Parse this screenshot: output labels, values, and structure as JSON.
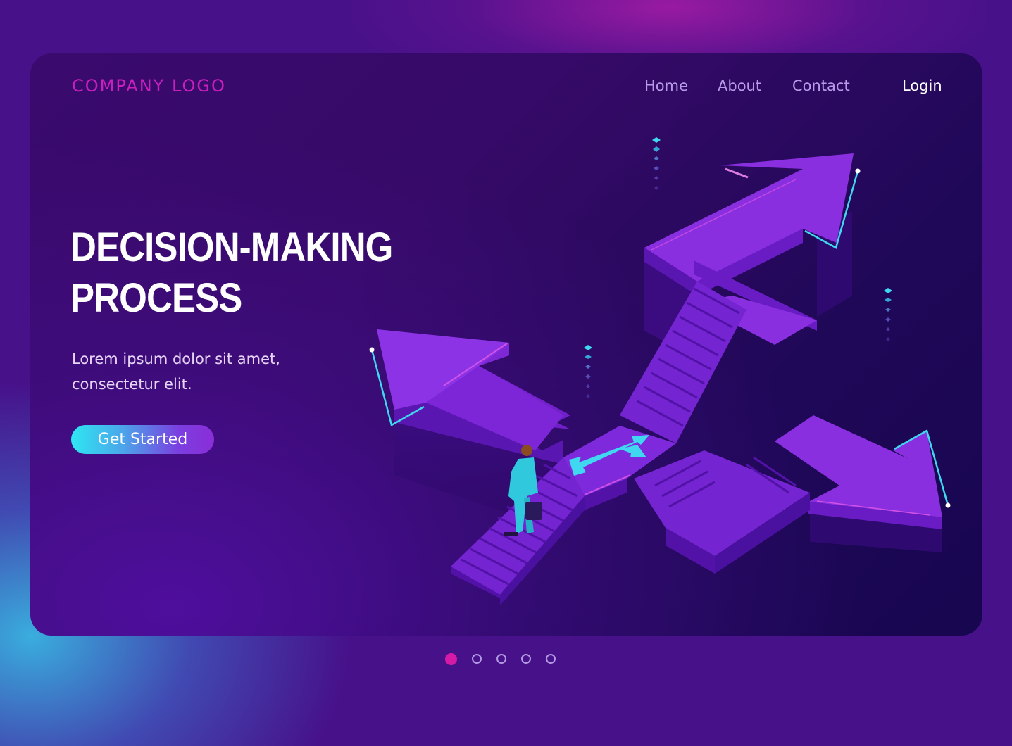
{
  "header": {
    "logo_text": "COMPANY LOGO",
    "nav": [
      {
        "label": "Home"
      },
      {
        "label": "About"
      },
      {
        "label": "Contact"
      },
      {
        "label": "Login"
      }
    ]
  },
  "hero": {
    "title_line1": "DECISION-MAKING",
    "title_line2": "PROCESS",
    "subtitle_line1": "Lorem ipsum dolor sit amet,",
    "subtitle_line2": "consectetur elit.",
    "cta_label": "Get Started"
  },
  "illustration": {
    "subject": "isometric staircase with three directional arrows and businessman",
    "arrows": [
      "up-left",
      "up-right",
      "down-right"
    ],
    "floor_icon": "split-direction-arrows-icon"
  },
  "pagination": {
    "total": 5,
    "active": 1
  },
  "colors": {
    "background": "#47118a",
    "card": "#2a0862",
    "logo": "#c81fbe",
    "nav_link": "#b89be8",
    "accent_cyan": "#2ee6f2",
    "accent_purple": "#8a2dd8",
    "active_dot": "#d61aa8",
    "stair_purple": "#7a22d6"
  }
}
